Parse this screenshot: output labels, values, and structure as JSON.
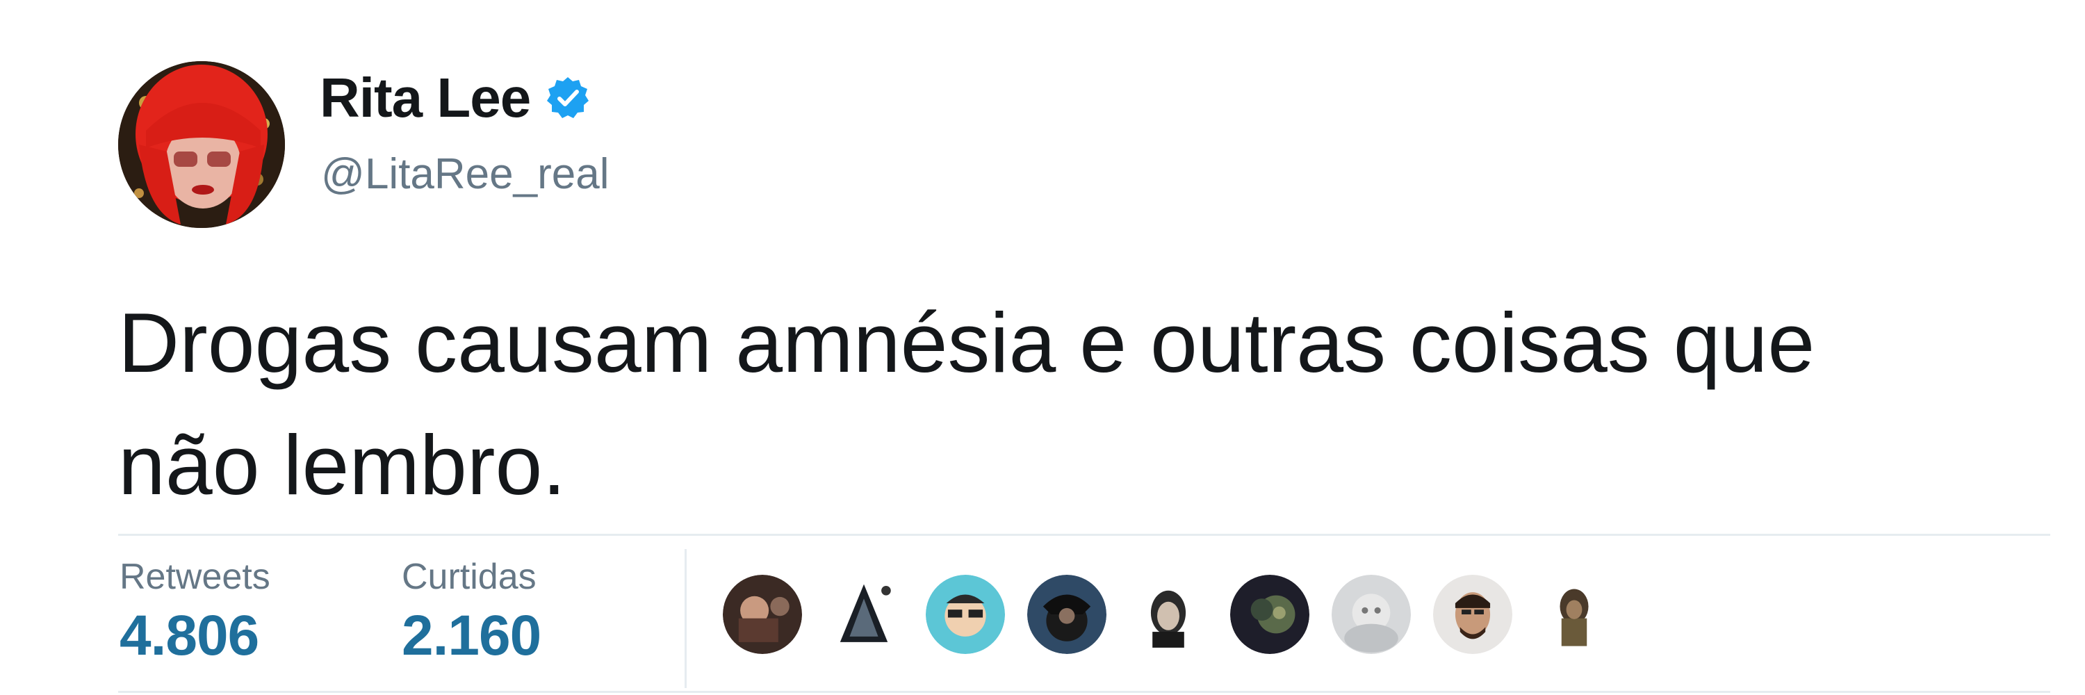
{
  "tweet": {
    "author": {
      "display_name": "Rita Lee",
      "handle": "@LitaRee_real",
      "verified": true
    },
    "text_lines": [
      "Drogas causam amnésia e outras coisas que",
      "não lembro."
    ],
    "stats": {
      "retweets_label": "Retweets",
      "retweets_value": "4.806",
      "likes_label": "Curtidas",
      "likes_value": "2.160"
    },
    "likers_count_shown": 9
  },
  "colors": {
    "text": "#14171a",
    "secondary_text": "#657786",
    "stat_value": "#1f6f9c",
    "verified_badge": "#1da1f2",
    "divider": "#e6ecf0"
  },
  "icons": {
    "verified": "verified-badge-icon"
  }
}
